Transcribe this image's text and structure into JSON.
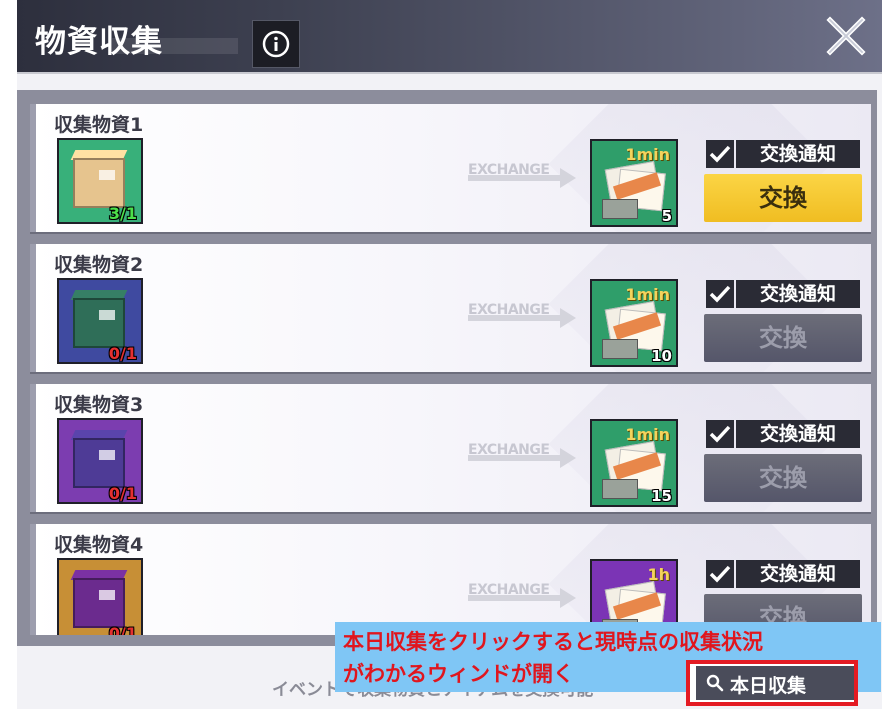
{
  "window": {
    "title": "物資収集",
    "info_icon": "info-icon",
    "close_icon": "close-icon"
  },
  "items": [
    {
      "name": "収集物資1",
      "count": "3/1",
      "count_color": "#4ce04a",
      "box_bg": "#38b07a",
      "crate_color": "#e6c48e",
      "exchange_label": "EXCHANGE",
      "reward_time": "1min",
      "reward_count": "5",
      "reward_bg": "#2f9e6a",
      "notify_label": "交換通知",
      "notify_checked": true,
      "button_label": "交換",
      "button_active": true
    },
    {
      "name": "収集物資2",
      "count": "0/1",
      "count_color": "#e53030",
      "box_bg": "#3f4aa0",
      "crate_color": "#2f6e58",
      "exchange_label": "EXCHANGE",
      "reward_time": "1min",
      "reward_count": "10",
      "reward_bg": "#2f9e6a",
      "notify_label": "交換通知",
      "notify_checked": true,
      "button_label": "交換",
      "button_active": false
    },
    {
      "name": "収集物資3",
      "count": "0/1",
      "count_color": "#e53030",
      "box_bg": "#7c3db0",
      "crate_color": "#4e3b96",
      "exchange_label": "EXCHANGE",
      "reward_time": "1min",
      "reward_count": "15",
      "reward_bg": "#2f9e6a",
      "notify_label": "交換通知",
      "notify_checked": true,
      "button_label": "交換",
      "button_active": false
    },
    {
      "name": "収集物資4",
      "count": "0/1",
      "count_color": "#e53030",
      "box_bg": "#c78f36",
      "crate_color": "#6b2b8e",
      "exchange_label": "EXCHANGE",
      "reward_time": "1h",
      "reward_count": "",
      "reward_bg": "#7b34b5",
      "notify_label": "交換通知",
      "notify_checked": true,
      "button_label": "交換",
      "button_active": false
    }
  ],
  "footer": {
    "note": "イベントで収集物資とアイテムを交換可能",
    "daily_button": "本日収集",
    "search_icon": "search-icon"
  },
  "annotation": {
    "line1": "本日収集をクリックすると現時点の収集状況",
    "line2": "がわかるウィンドが開く"
  }
}
